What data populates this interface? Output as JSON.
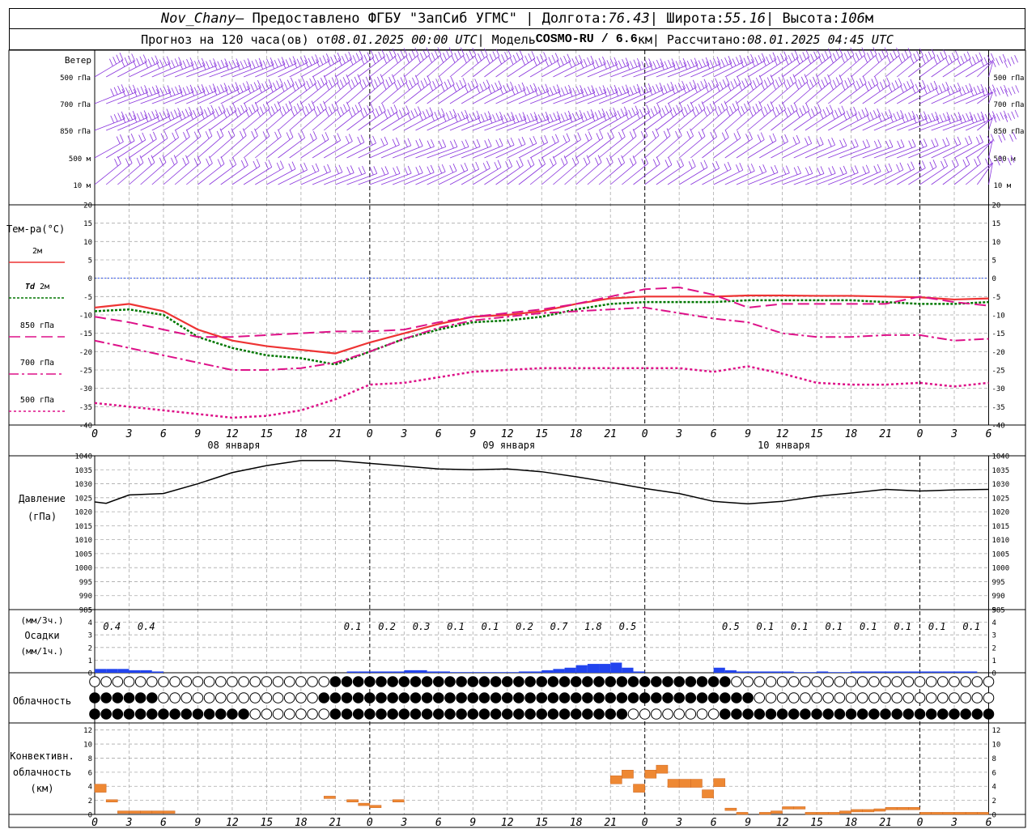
{
  "header": {
    "line1": {
      "station": "Nov_Chany",
      "provider": " – Предоставлено ФГБУ \"ЗапСиб УГМС\" | Долгота: ",
      "lon": "76.43",
      "lat_label": " | Широта: ",
      "lat": "55.16",
      "alt_label": " | Высота: ",
      "alt": "106",
      "alt_unit": "м"
    },
    "line2": {
      "prefix": "Прогноз на 120 часа(ов) от ",
      "start": "08.01.2025 00:00 UTC",
      "model_label": " | Модель ",
      "model": "COSMO-RU / 6.6",
      "model_unit": "км",
      "calc_label": " | Рассчитано: ",
      "calc": "08.01.2025 04:45 UTC"
    }
  },
  "axes": {
    "hour_ticks": [
      "0",
      "3",
      "6",
      "9",
      "12",
      "15",
      "18",
      "21",
      "0",
      "3",
      "6",
      "9",
      "12",
      "15",
      "18",
      "21",
      "0",
      "3",
      "6",
      "9",
      "12",
      "15",
      "18",
      "21",
      "0",
      "3",
      "6"
    ],
    "day_labels": [
      "08 января",
      "09 января",
      "10 января"
    ]
  },
  "wind_panel": {
    "title": "Ветер",
    "levels": [
      "500 гПа",
      "700 гПа",
      "850 гПа",
      "500 м",
      "10 м"
    ]
  },
  "temp_panel": {
    "title": "Тем-ра(°C)",
    "legend": [
      {
        "label": "2м",
        "color": "#ee3333",
        "dash": "solid"
      },
      {
        "label_italic": "Td",
        "label": " 2м",
        "color": "#007700",
        "dash": "dot"
      },
      {
        "label": "850 гПа",
        "color": "#dd1188",
        "dash": "long-dash"
      },
      {
        "label": "700 гПа",
        "color": "#dd1188",
        "dash": "dash-dot"
      },
      {
        "label": "500 гПа",
        "color": "#dd1188",
        "dash": "dotted"
      }
    ],
    "ticks": [
      "20",
      "15",
      "10",
      "5",
      "0",
      "-5",
      "-10",
      "-15",
      "-20",
      "-25",
      "-30",
      "-35",
      "-40"
    ]
  },
  "pressure_panel": {
    "title1": "Давление",
    "title2": "(гПа)",
    "ticks": [
      "1040",
      "1035",
      "1030",
      "1025",
      "1020",
      "1015",
      "1010",
      "1005",
      "1000",
      "995",
      "990",
      "985"
    ]
  },
  "precip_panel": {
    "title1": "(мм/3ч.)",
    "title2": "Осадки",
    "title3": "(мм/1ч.)",
    "ticks": [
      "5",
      "4",
      "3",
      "2",
      "1",
      "0"
    ],
    "totals": [
      "0.4",
      "0.4",
      "0.1",
      "0.2",
      "0.3",
      "0.1",
      "0.1",
      "0.2",
      "0.7",
      "1.8",
      "0.5",
      "0.5",
      "0.1",
      "0.1",
      "0.1",
      "0.1",
      "0.1",
      "0.1",
      "0.1"
    ]
  },
  "cloud_panel": {
    "title": "Облачность"
  },
  "conv_panel": {
    "title1": "Конвективн.",
    "title2": "облачность",
    "title3": "(км)",
    "ticks": [
      "12",
      "10",
      "8",
      "6",
      "4",
      "2",
      "0"
    ]
  },
  "colors": {
    "wind": "#8833dd",
    "pressure": "#000000",
    "precip": "#2244ee",
    "conv": "#ee8833",
    "grid": "#aaaaaa",
    "zero_line": "#3355ee"
  },
  "chart_data": [
    {
      "type": "line",
      "name": "temperature",
      "x": [
        0,
        3,
        6,
        9,
        12,
        15,
        18,
        21,
        24,
        27,
        30,
        33,
        36,
        39,
        42,
        45,
        48,
        51,
        54,
        57,
        60,
        63,
        66,
        69,
        72,
        75,
        78
      ],
      "ylim": [
        -40,
        20
      ],
      "series": [
        {
          "name": "2м",
          "values": [
            -8,
            -7,
            -9,
            -14,
            -17,
            -18.5,
            -19.5,
            -20.5,
            -17.5,
            -15,
            -12.5,
            -10.5,
            -10,
            -9,
            -7,
            -5.5,
            -5,
            -5,
            -5,
            -4.7,
            -4.7,
            -4.8,
            -4.8,
            -5,
            -5.2,
            -5.8,
            -5.5
          ]
        },
        {
          "name": "Td 2м",
          "values": [
            -9,
            -8.5,
            -10,
            -16,
            -19,
            -21,
            -21.8,
            -23.5,
            -20,
            -16.5,
            -14,
            -12,
            -11.5,
            -10.5,
            -8.5,
            -7,
            -6.5,
            -6.5,
            -6.5,
            -6,
            -6,
            -6,
            -6,
            -6.5,
            -7,
            -7,
            -6.5
          ]
        },
        {
          "name": "850 гПа",
          "values": [
            -10.5,
            -12,
            -14,
            -16,
            -16,
            -15.5,
            -15,
            -14.5,
            -14.5,
            -14,
            -12,
            -10.5,
            -9.5,
            -8.5,
            -7,
            -5,
            -3,
            -2.5,
            -4.5,
            -8,
            -7,
            -7,
            -7,
            -7,
            -5,
            -6.5,
            -7.5
          ]
        },
        {
          "name": "700 гПа",
          "values": [
            -17,
            -19,
            -21,
            -23,
            -25,
            -25,
            -24.5,
            -23,
            -20,
            -16.5,
            -13.5,
            -11.5,
            -10.5,
            -9.5,
            -9,
            -8.5,
            -8,
            -9.5,
            -11,
            -12,
            -15,
            -16,
            -16,
            -15.5,
            -15.5,
            -17,
            -16.5
          ]
        },
        {
          "name": "500 гПа",
          "values": [
            -34,
            -35,
            -36,
            -37,
            -38,
            -37.5,
            -36,
            -33,
            -29,
            -28.5,
            -27,
            -25.5,
            -25,
            -24.5,
            -24.5,
            -24.5,
            -24.5,
            -24.5,
            -25.5,
            -24,
            -26,
            -28.5,
            -29,
            -29,
            -28.5,
            -29.5,
            -28.5
          ]
        }
      ]
    },
    {
      "type": "line",
      "name": "pressure",
      "x": [
        0,
        1,
        3,
        6,
        9,
        12,
        15,
        18,
        21,
        24,
        27,
        30,
        33,
        36,
        39,
        42,
        45,
        48,
        51,
        54,
        57,
        60,
        63,
        66,
        69,
        72,
        75,
        78
      ],
      "ylim": [
        985,
        1040
      ],
      "values": [
        1023.5,
        1023,
        1026,
        1026.5,
        1030,
        1034,
        1036.5,
        1038.3,
        1038.3,
        1037.3,
        1036.3,
        1035.3,
        1035,
        1035.3,
        1034.3,
        1032.5,
        1030.5,
        1028.3,
        1026.5,
        1023.7,
        1022.8,
        1023.7,
        1025.5,
        1026.7,
        1028,
        1027.4,
        1027.8,
        1028
      ]
    },
    {
      "type": "bar",
      "name": "precipitation",
      "ylim": [
        0,
        5
      ],
      "x": [
        1,
        2,
        3,
        4,
        5,
        6,
        23,
        24,
        25,
        26,
        27,
        28,
        29,
        30,
        31,
        32,
        33,
        34,
        35,
        36,
        37,
        38,
        39,
        40,
        41,
        42,
        43,
        44,
        45,
        46,
        47,
        48,
        55,
        56,
        57,
        58,
        59,
        60,
        61,
        62,
        63,
        64,
        65,
        66,
        67,
        68,
        69,
        70,
        71,
        72,
        73,
        74,
        75,
        76,
        77
      ],
      "values": [
        0.3,
        0.3,
        0.3,
        0.2,
        0.2,
        0.1,
        0.1,
        0.1,
        0.1,
        0.1,
        0.1,
        0.2,
        0.2,
        0.1,
        0.1,
        0.05,
        0.05,
        0.05,
        0.05,
        0.05,
        0.05,
        0.1,
        0.1,
        0.2,
        0.3,
        0.4,
        0.6,
        0.7,
        0.7,
        0.8,
        0.4,
        0.1,
        0.4,
        0.2,
        0.1,
        0.1,
        0.1,
        0.1,
        0.1,
        0.05,
        0.05,
        0.1,
        0.05,
        0.05,
        0.1,
        0.1,
        0.1,
        0.1,
        0.1,
        0.1,
        0.1,
        0.1,
        0.1,
        0.1,
        0.1
      ]
    },
    {
      "type": "bar",
      "name": "convective",
      "ylim": [
        0,
        13
      ],
      "x": [
        1,
        2,
        3,
        4,
        5,
        6,
        7,
        21,
        23,
        24,
        25,
        27,
        46,
        47,
        48,
        49,
        50,
        51,
        52,
        53,
        54,
        55,
        56,
        57,
        59,
        60,
        61,
        62,
        63,
        64,
        65,
        66,
        67,
        68,
        69,
        70,
        71,
        72,
        73,
        74,
        75,
        76,
        77,
        78
      ],
      "values": [
        4.3,
        2.1,
        0.5,
        0.5,
        0.5,
        0.5,
        0.5,
        2.6,
        2.1,
        1.6,
        1.3,
        2.1,
        5.5,
        6.3,
        4.3,
        6.3,
        7,
        5,
        5,
        5,
        3.5,
        5.1,
        0.9,
        0.3,
        0.3,
        0.5,
        1.1,
        1.1,
        0.3,
        0.3,
        0.3,
        0.5,
        0.7,
        0.7,
        0.8,
        1,
        1,
        1,
        0.3,
        0.3,
        0.3,
        0.3,
        0.3,
        0.3
      ]
    }
  ]
}
